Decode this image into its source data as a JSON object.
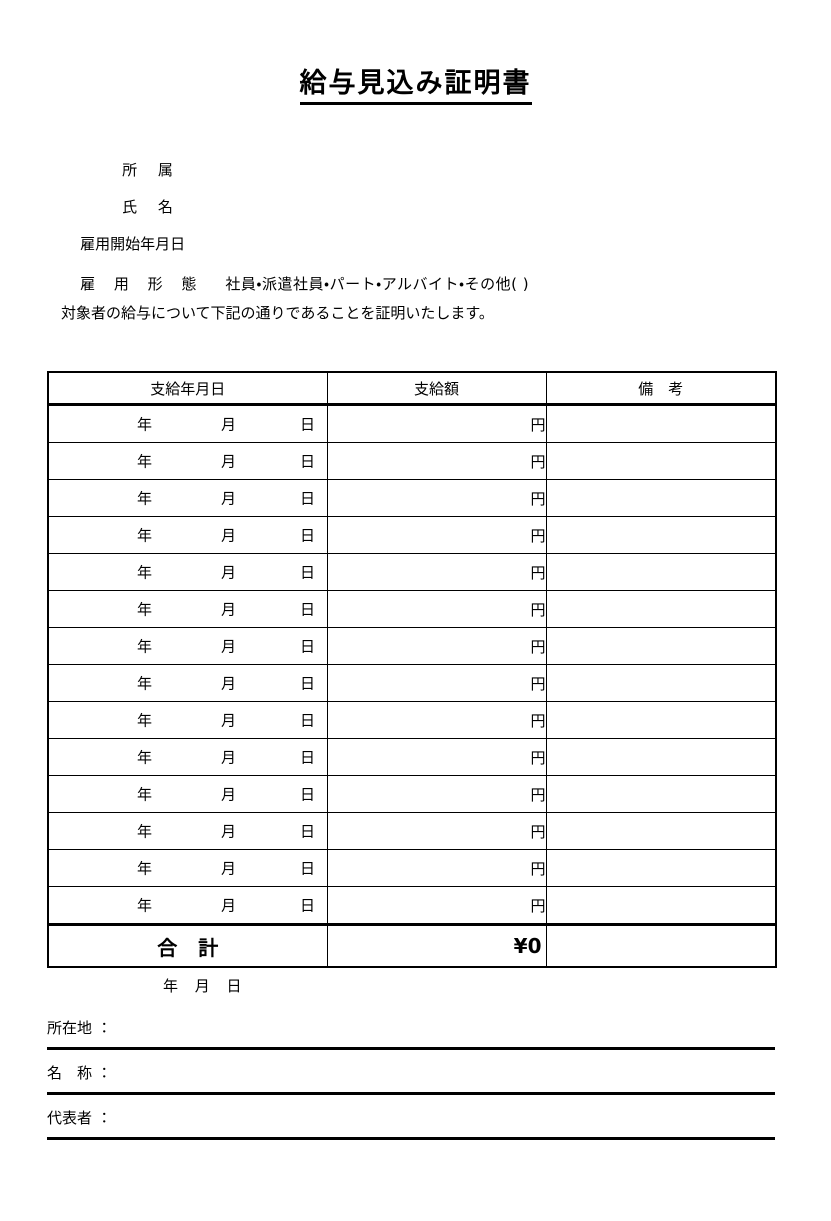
{
  "document": {
    "title": "給与見込み証明書"
  },
  "header": {
    "affiliation_label": "所 属",
    "affiliation_value": "",
    "name_label": "氏 名",
    "name_value": "",
    "employment_start_label": "雇用開始年月日",
    "employment_start_value": "",
    "employment_type_label": "雇 用 形 態",
    "employment_type_options": "社員・派遣社員・パート・アルバイト・その他( )",
    "statement": "対象者の給与について下記の通りであることを証明いたします。"
  },
  "table": {
    "columns": [
      "支給年月日",
      "支給額",
      "備　考"
    ],
    "date_parts": {
      "year": "年",
      "month": "月",
      "day": "日"
    },
    "currency_unit": "円",
    "row_count": 14,
    "rows": [
      {
        "year": "年",
        "month": "月",
        "day": "日",
        "amount": "",
        "unit": "円",
        "note": ""
      },
      {
        "year": "年",
        "month": "月",
        "day": "日",
        "amount": "",
        "unit": "円",
        "note": ""
      },
      {
        "year": "年",
        "month": "月",
        "day": "日",
        "amount": "",
        "unit": "円",
        "note": ""
      },
      {
        "year": "年",
        "month": "月",
        "day": "日",
        "amount": "",
        "unit": "円",
        "note": ""
      },
      {
        "year": "年",
        "month": "月",
        "day": "日",
        "amount": "",
        "unit": "円",
        "note": ""
      },
      {
        "year": "年",
        "month": "月",
        "day": "日",
        "amount": "",
        "unit": "円",
        "note": ""
      },
      {
        "year": "年",
        "month": "月",
        "day": "日",
        "amount": "",
        "unit": "円",
        "note": ""
      },
      {
        "year": "年",
        "month": "月",
        "day": "日",
        "amount": "",
        "unit": "円",
        "note": ""
      },
      {
        "year": "年",
        "month": "月",
        "day": "日",
        "amount": "",
        "unit": "円",
        "note": ""
      },
      {
        "year": "年",
        "month": "月",
        "day": "日",
        "amount": "",
        "unit": "円",
        "note": ""
      },
      {
        "year": "年",
        "month": "月",
        "day": "日",
        "amount": "",
        "unit": "円",
        "note": ""
      },
      {
        "year": "年",
        "month": "月",
        "day": "日",
        "amount": "",
        "unit": "円",
        "note": ""
      },
      {
        "year": "年",
        "month": "月",
        "day": "日",
        "amount": "",
        "unit": "円",
        "note": ""
      },
      {
        "year": "年",
        "month": "月",
        "day": "日",
        "amount": "",
        "unit": "円",
        "note": ""
      }
    ],
    "total": {
      "label": "合 計",
      "amount": "¥0",
      "note": ""
    }
  },
  "footer": {
    "date_line": "年 月 日",
    "fields": [
      {
        "label": "所在地 ：",
        "value": ""
      },
      {
        "label": "名　称 ：",
        "value": ""
      },
      {
        "label": "代表者 ：",
        "value": ""
      }
    ]
  },
  "colors": {
    "text": "#000000",
    "rule": "#000000",
    "background": "#ffffff"
  }
}
